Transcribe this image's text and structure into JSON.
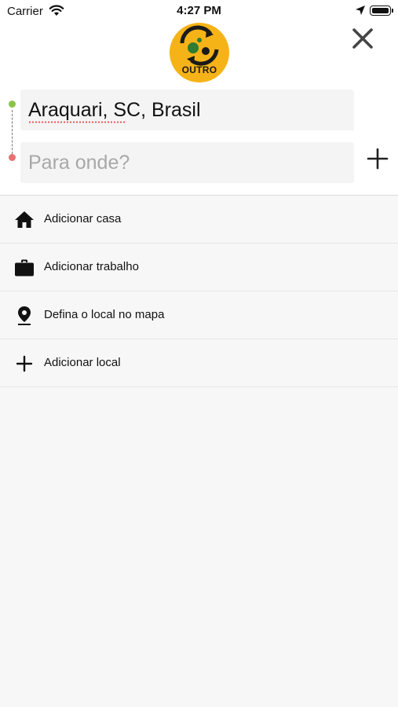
{
  "status_bar": {
    "carrier": "Carrier",
    "time": "4:27 PM"
  },
  "logo": {
    "text": "OUTRO",
    "icon": "brand-logo-icon",
    "color": "#f6b318"
  },
  "header": {
    "close_icon": "close-icon",
    "add_stop_icon": "plus-icon"
  },
  "route": {
    "origin_value": "Araquari, SC, Brasil",
    "destination_placeholder": "Para onde?",
    "start_dot_color": "#8bc34a",
    "end_dot_color": "#e57373"
  },
  "options": [
    {
      "label": "Adicionar casa",
      "icon": "home-icon"
    },
    {
      "label": "Adicionar trabalho",
      "icon": "briefcase-icon"
    },
    {
      "label": "Defina o local no mapa",
      "icon": "map-pin-icon"
    },
    {
      "label": "Adicionar local",
      "icon": "plus-icon"
    }
  ]
}
